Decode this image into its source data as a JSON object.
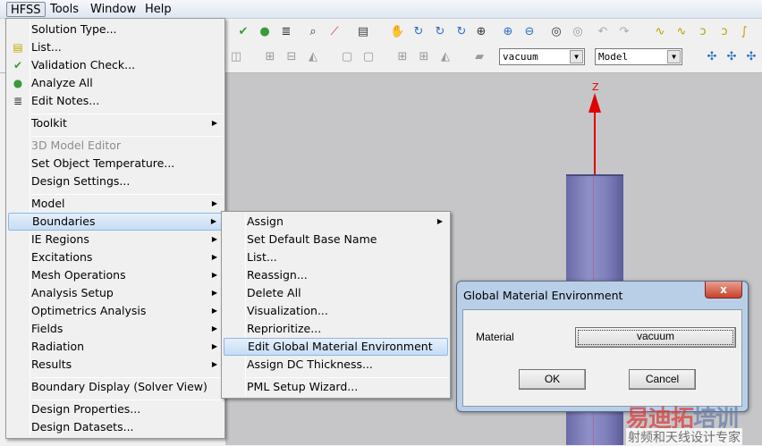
{
  "menubar": [
    "HFSS",
    "Tools",
    "Window",
    "Help"
  ],
  "toolbar": {
    "material_combo": "vacuum",
    "view_combo": "Model"
  },
  "viewport": {
    "axis_label": "Z"
  },
  "hfss_menu": [
    {
      "label": "Solution Type...",
      "icon": ""
    },
    {
      "label": "List...",
      "icon": "list-icon"
    },
    {
      "label": "Validation Check...",
      "icon": "validation-check-icon"
    },
    {
      "label": "Analyze All",
      "icon": "analyze-icon"
    },
    {
      "label": "Edit Notes...",
      "icon": "notes-icon"
    },
    {
      "sep": true
    },
    {
      "label": "Toolkit",
      "submenu": true
    },
    {
      "sep": true
    },
    {
      "label": "3D Model Editor",
      "disabled": true
    },
    {
      "label": "Set Object Temperature..."
    },
    {
      "label": "Design Settings..."
    },
    {
      "sep": true
    },
    {
      "label": "Model",
      "submenu": true
    },
    {
      "label": "Boundaries",
      "submenu": true,
      "highlighted": true
    },
    {
      "label": "IE Regions",
      "submenu": true
    },
    {
      "label": "Excitations",
      "submenu": true
    },
    {
      "label": "Mesh Operations",
      "submenu": true
    },
    {
      "label": "Analysis Setup",
      "submenu": true
    },
    {
      "label": "Optimetrics Analysis",
      "submenu": true
    },
    {
      "label": "Fields",
      "submenu": true
    },
    {
      "label": "Radiation",
      "submenu": true
    },
    {
      "label": "Results",
      "submenu": true
    },
    {
      "sep": true
    },
    {
      "label": "Boundary Display (Solver View)"
    },
    {
      "sep": true
    },
    {
      "label": "Design Properties..."
    },
    {
      "label": "Design Datasets..."
    }
  ],
  "boundaries_menu": [
    {
      "label": "Assign",
      "submenu": true
    },
    {
      "label": "Set Default Base Name"
    },
    {
      "label": "List..."
    },
    {
      "label": "Reassign..."
    },
    {
      "label": "Delete All"
    },
    {
      "label": "Visualization..."
    },
    {
      "label": "Reprioritize..."
    },
    {
      "label": "Edit Global Material Environment",
      "highlighted": true
    },
    {
      "label": "Assign DC Thickness..."
    },
    {
      "sep": true
    },
    {
      "label": "PML Setup Wizard..."
    }
  ],
  "dialog": {
    "title": "Global Material Environment",
    "close": "x",
    "material_label": "Material",
    "material_value": "vacuum",
    "ok": "OK",
    "cancel": "Cancel"
  },
  "watermark": {
    "line1a": "易迪拓",
    "line1b": "培训",
    "line2": "射频和天线设计专家"
  }
}
